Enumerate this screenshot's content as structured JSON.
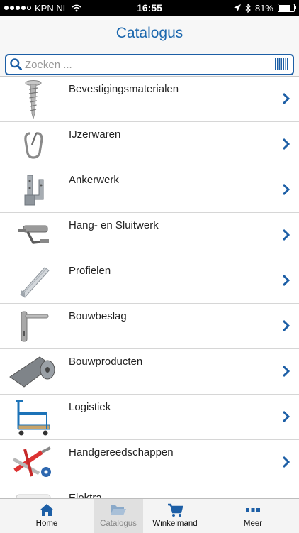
{
  "status_bar": {
    "carrier": "KPN NL",
    "time": "16:55",
    "battery": "81%",
    "battery_level": 0.81
  },
  "header": {
    "title": "Catalogus"
  },
  "search": {
    "placeholder": "Zoeken ...",
    "value": ""
  },
  "categories": [
    {
      "label": "Bevestigingsmaterialen",
      "icon": "screw-icon"
    },
    {
      "label": "IJzerwaren",
      "icon": "carabiner-icon"
    },
    {
      "label": "Ankerwerk",
      "icon": "anchor-bracket-icon"
    },
    {
      "label": "Hang- en Sluitwerk",
      "icon": "door-closer-icon"
    },
    {
      "label": "Profielen",
      "icon": "profile-bar-icon"
    },
    {
      "label": "Bouwbeslag",
      "icon": "door-handle-icon"
    },
    {
      "label": "Bouwproducten",
      "icon": "roll-icon"
    },
    {
      "label": "Logistiek",
      "icon": "trolley-icon"
    },
    {
      "label": "Handgereedschappen",
      "icon": "tools-icon"
    },
    {
      "label": "Elektra",
      "icon": "electric-box-icon"
    }
  ],
  "tabbar": {
    "tabs": [
      {
        "label": "Home",
        "icon": "home-icon"
      },
      {
        "label": "Catalogus",
        "icon": "folder-icon",
        "active": true
      },
      {
        "label": "Winkelmand",
        "icon": "cart-icon"
      },
      {
        "label": "Meer",
        "icon": "more-icon"
      }
    ]
  },
  "colors": {
    "accent": "#1b67ae",
    "chevron": "#1d5fa6"
  }
}
